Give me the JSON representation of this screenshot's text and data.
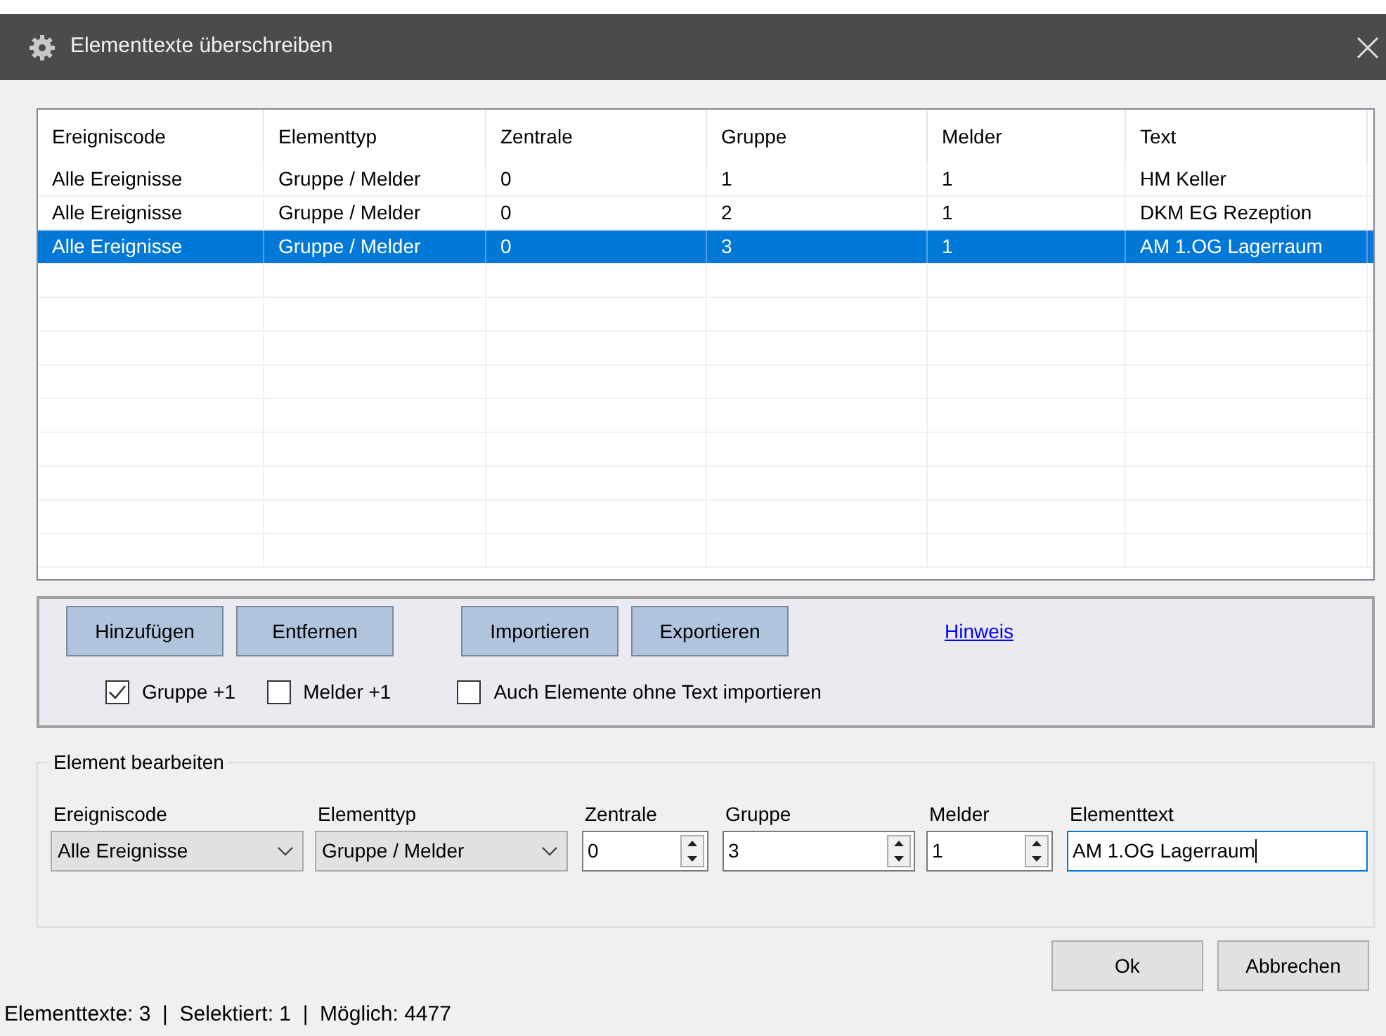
{
  "window": {
    "title": "Elementtexte überschreiben"
  },
  "table": {
    "columns": [
      "Ereigniscode",
      "Elementtyp",
      "Zentrale",
      "Gruppe",
      "Melder",
      "Text"
    ],
    "rows": [
      {
        "cells": [
          "Alle Ereignisse",
          "Gruppe / Melder",
          "0",
          "1",
          "1",
          "HM Keller"
        ],
        "selected": false
      },
      {
        "cells": [
          "Alle Ereignisse",
          "Gruppe / Melder",
          "0",
          "2",
          "1",
          "DKM EG Rezeption"
        ],
        "selected": false
      },
      {
        "cells": [
          "Alle Ereignisse",
          "Gruppe / Melder",
          "0",
          "3",
          "1",
          "AM 1.OG Lagerraum"
        ],
        "selected": true
      }
    ]
  },
  "toolbar": {
    "buttons": [
      "Hinzufügen",
      "Entfernen",
      "Importieren",
      "Exportieren"
    ],
    "link": "Hinweis",
    "checkboxes": [
      {
        "label": "Gruppe +1",
        "checked": true
      },
      {
        "label": "Melder +1",
        "checked": false
      },
      {
        "label": "Auch Elemente ohne Text importieren",
        "checked": false
      }
    ]
  },
  "editor": {
    "title": "Element bearbeiten",
    "fields": [
      {
        "kind": "combo",
        "label": "Ereigniscode",
        "value": "Alle Ereignisse"
      },
      {
        "kind": "combo",
        "label": "Elementtyp",
        "value": "Gruppe / Melder"
      },
      {
        "kind": "spin",
        "label": "Zentrale",
        "value": "0"
      },
      {
        "kind": "spin",
        "label": "Gruppe",
        "value": "3"
      },
      {
        "kind": "spin",
        "label": "Melder",
        "value": "1"
      },
      {
        "kind": "text",
        "label": "Elementtext",
        "value": "AM 1.OG Lagerraum"
      }
    ]
  },
  "buttons": [
    "Ok",
    "Abbrechen"
  ],
  "status_bar": "Elementtexte: 3  |  Selektiert: 1  |  Möglich: 4477"
}
